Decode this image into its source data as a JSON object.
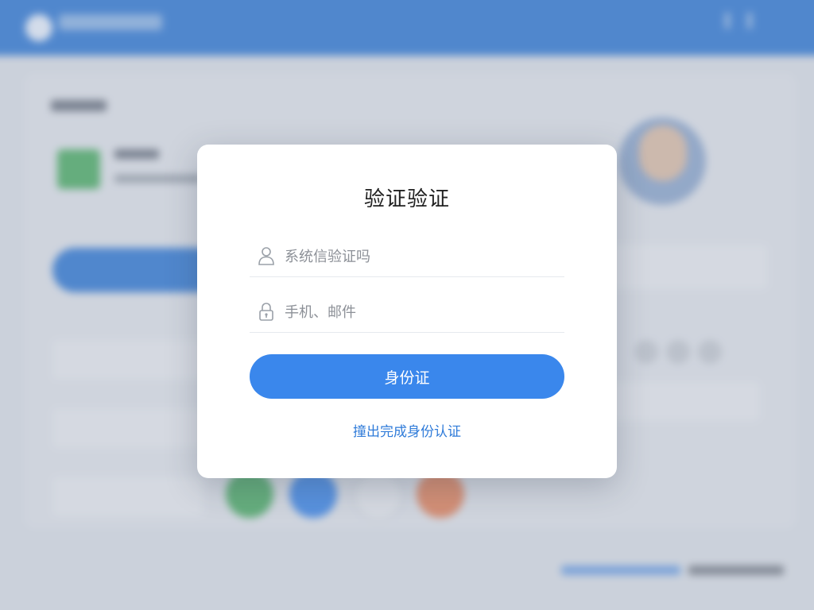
{
  "modal": {
    "title": "验证验证",
    "field1_placeholder": "系统信验证吗",
    "field2_placeholder": "手机、邮件",
    "submit_label": "身份证",
    "link_label": "撞出完成身份认证"
  },
  "colors": {
    "brand": "#2f79d6",
    "button": "#3a87ec",
    "link": "#2f7bd9"
  },
  "icons": {
    "field1": "user-icon",
    "field2": "lock-icon"
  }
}
